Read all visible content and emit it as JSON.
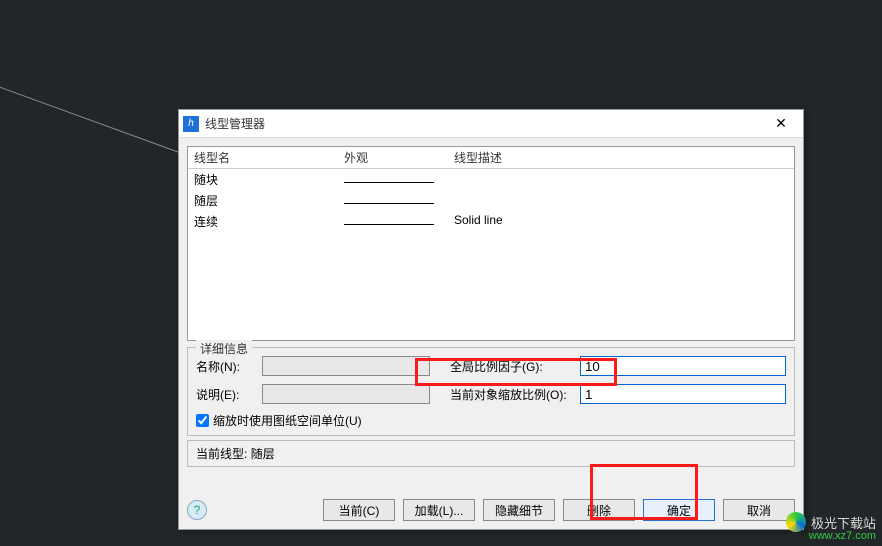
{
  "dialog": {
    "title": "线型管理器",
    "close": "✕"
  },
  "list": {
    "headers": {
      "name": "线型名",
      "appearance": "外观",
      "desc": "线型描述"
    },
    "rows": [
      {
        "name": "随块",
        "desc": ""
      },
      {
        "name": "随层",
        "desc": ""
      },
      {
        "name": "连续",
        "desc": "Solid line"
      }
    ]
  },
  "details": {
    "group_label": "详细信息",
    "name_label": "名称(N):",
    "name_value": "",
    "global_label": "全局比例因子(G):",
    "global_value": "10",
    "desc_label": "说明(E):",
    "desc_value": "",
    "current_scale_label": "当前对象缩放比例(O):",
    "current_scale_value": "1",
    "use_paperspace": "缩放时使用图纸空间单位(U)"
  },
  "current": {
    "label": "当前线型:",
    "value": "随层"
  },
  "buttons": {
    "help": "?",
    "current": "当前(C)",
    "load": "加载(L)...",
    "hide": "隐藏细节",
    "delete": "删除",
    "ok": "确定",
    "cancel": "取消"
  },
  "watermark": {
    "line1": "极光下载站",
    "line2": "www.xz7.com"
  }
}
